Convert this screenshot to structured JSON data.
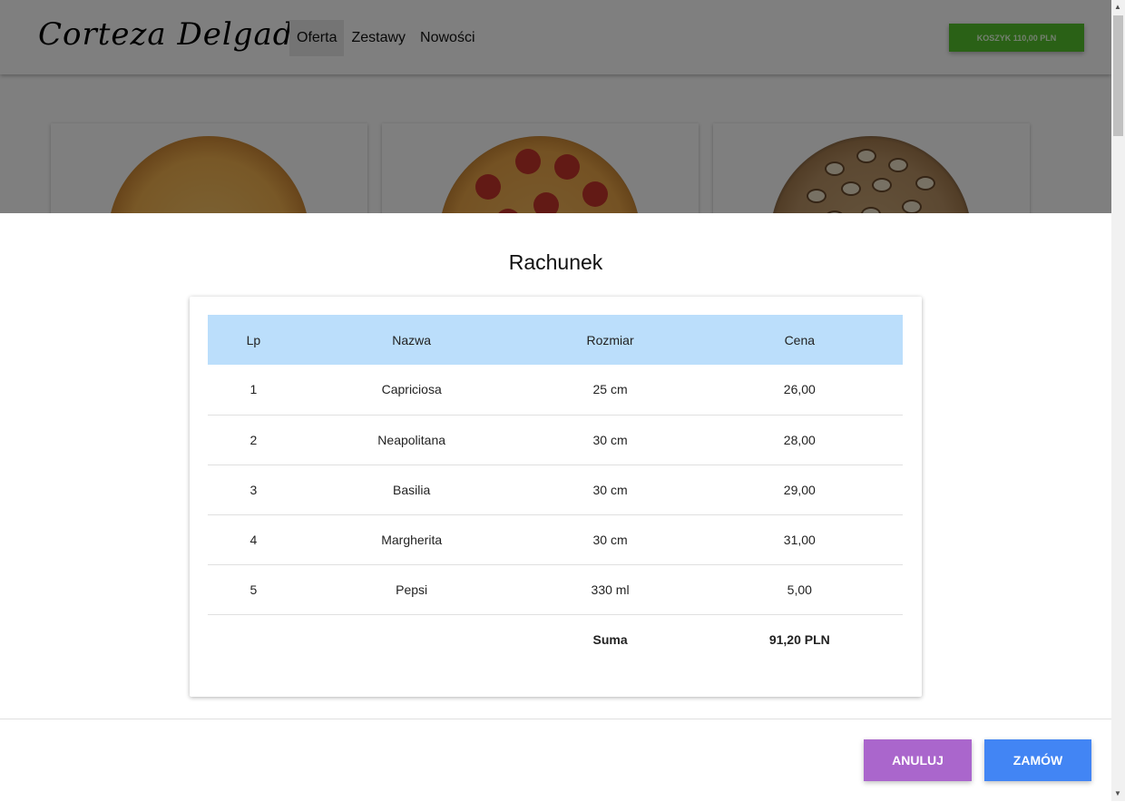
{
  "header": {
    "brand": "Corteza Delgada",
    "nav": [
      "Oferta",
      "Zestawy",
      "Nowości"
    ],
    "cart_label": "KOSZYK 110,00 PLN"
  },
  "modal": {
    "title": "Rachunek",
    "columns": [
      "Lp",
      "Nazwa",
      "Rozmiar",
      "Cena"
    ],
    "rows": [
      [
        "1",
        "Capriciosa",
        "25 cm",
        "26,00"
      ],
      [
        "2",
        "Neapolitana",
        "30 cm",
        "28,00"
      ],
      [
        "3",
        "Basilia",
        "30 cm",
        "29,00"
      ],
      [
        "4",
        "Margherita",
        "30 cm",
        "31,00"
      ],
      [
        "5",
        "Pepsi",
        "330 ml",
        "5,00"
      ]
    ],
    "sum_label": "Suma",
    "sum_value": "91,20 PLN",
    "cancel_label": "ANULUJ",
    "order_label": "ZAMÓW"
  },
  "colors": {
    "cart_green": "#55c32c",
    "table_header": "#bbdefb",
    "cancel_purple": "#aa66cc",
    "order_blue": "#4285f4"
  }
}
